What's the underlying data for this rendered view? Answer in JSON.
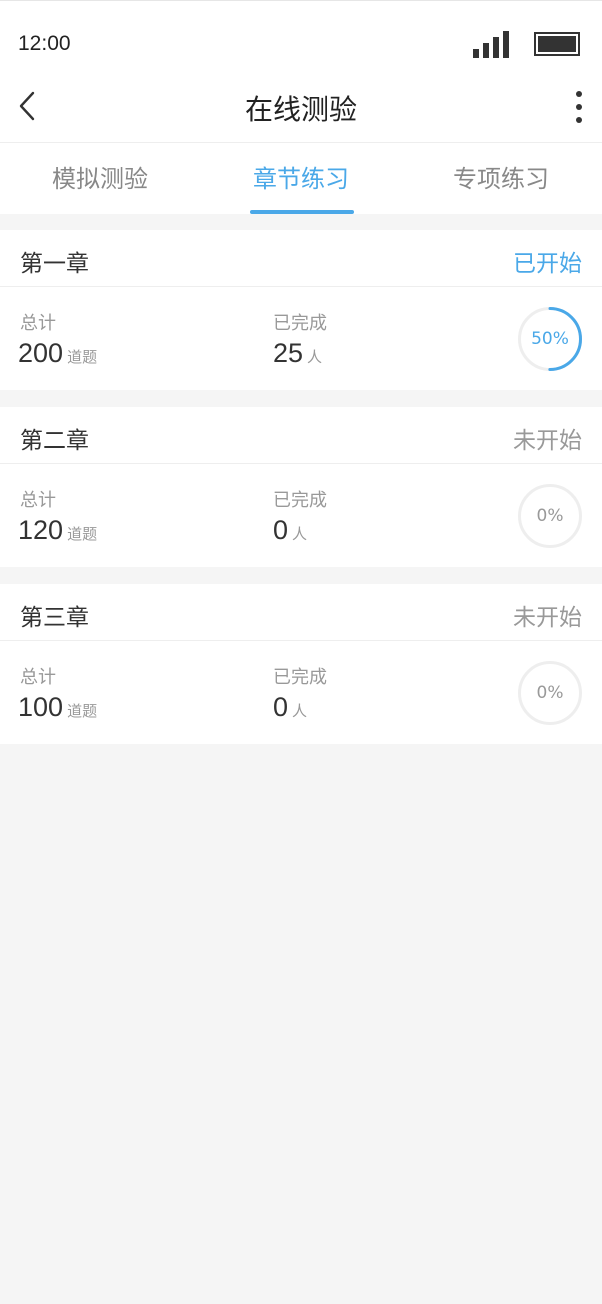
{
  "status_bar": {
    "time": "12:00"
  },
  "nav": {
    "title": "在线测验"
  },
  "tabs": [
    {
      "label": "模拟测验",
      "active": false
    },
    {
      "label": "章节练习",
      "active": true
    },
    {
      "label": "专项练习",
      "active": false
    }
  ],
  "chapters": [
    {
      "title": "第一章",
      "status": "已开始",
      "total_label": "总计",
      "total_value": "200",
      "total_unit": "道题",
      "done_label": "已完成",
      "done_value": "25",
      "done_unit": "人",
      "progress_text": "50%",
      "progress": 0.5
    },
    {
      "title": "第二章",
      "status": "未开始",
      "total_label": "总计",
      "total_value": "120",
      "total_unit": "道题",
      "done_label": "已完成",
      "done_value": "0",
      "done_unit": "人",
      "progress_text": "0%",
      "progress": 0
    },
    {
      "title": "第三章",
      "status": "未开始",
      "total_label": "总计",
      "total_value": "100",
      "total_unit": "道题",
      "done_label": "已完成",
      "done_value": "0",
      "done_unit": "人",
      "progress_text": "0%",
      "progress": 0
    }
  ],
  "colors": {
    "accent": "#4aa8e8",
    "muted": "#999999",
    "ring_track": "#eeeeee"
  },
  "icons": {
    "back": "chevron-left-icon",
    "more": "more-vertical-icon",
    "signal": "signal-icon",
    "battery": "battery-icon"
  }
}
